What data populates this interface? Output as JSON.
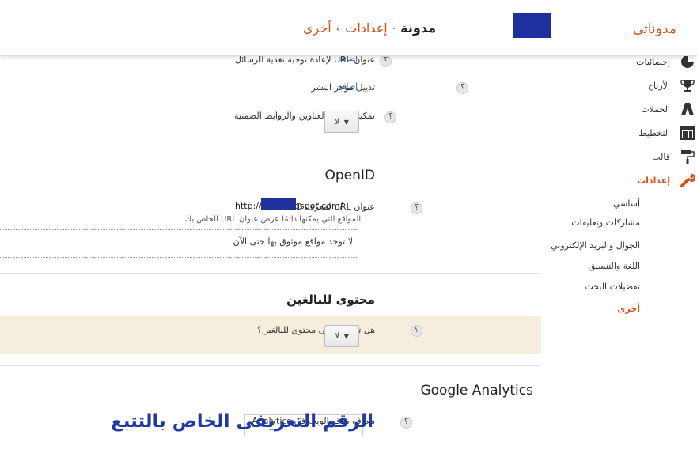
{
  "header": {
    "brand": "مدوناتي",
    "breadcrumb": {
      "blog_name": "مدونة",
      "settings": "إعدادات",
      "current": "أخرى",
      "sep": "›"
    }
  },
  "sidebar": {
    "items": [
      {
        "label": "إحصائيات",
        "icon": "pie-chart-icon"
      },
      {
        "label": "الأرباح",
        "icon": "trophy-icon"
      },
      {
        "label": "الحملات",
        "icon": "adwords-icon"
      },
      {
        "label": "التخطيط",
        "icon": "layout-icon"
      },
      {
        "label": "قالب",
        "icon": "paint-roller-icon"
      },
      {
        "label": "إعدادات",
        "icon": "wrench-icon",
        "active": true
      }
    ],
    "sub_items": [
      {
        "label": "أساسي"
      },
      {
        "label": "مشاركات وتعليقات"
      },
      {
        "label": "الجوال والبريد الإلكتروني"
      },
      {
        "label": "اللغة والتنسيق"
      },
      {
        "label": "تفضيلات البحث"
      },
      {
        "label": "أخرى",
        "active": true
      }
    ]
  },
  "feed_settings": {
    "redirect_label": "عنوان URL لإعادة توجيه تغذية الرسائل",
    "redirect_action": "إضافة",
    "footer_label": "تذييل موجز النشر",
    "footer_action": "إضافة",
    "links_label": "تمكين روابط العناوين والروابط الضمنية",
    "links_value": "لا",
    "help": "؟"
  },
  "openid": {
    "title": "OpenID",
    "url_label": "عنوان URL لمعرِّف OpenID",
    "url_value": "http://.......blogspot.com/",
    "sites_note": "المواقع التي يمكنها دائمًا عرض عنوان URL الخاص بك",
    "no_sites": "لا توجد مواقع موثوق بها حتى الآن"
  },
  "adult": {
    "title": "محتوى للبالغين",
    "question": "هل تشتمل على محتوى للبالغين؟",
    "value": "لا"
  },
  "analytics": {
    "title": "Google Analytics",
    "id_label": "معرف موقع الويب في Analytics",
    "id_value": "",
    "overlay_note": "الرقم التعريفى الخاص بالتتبع"
  },
  "colors": {
    "accent": "#d5541c",
    "banner": "#f5eedc",
    "annotation": "#1f3aa0"
  }
}
